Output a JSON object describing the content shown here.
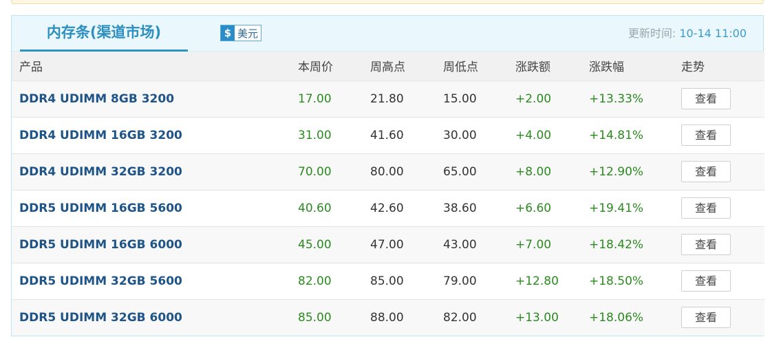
{
  "header": {
    "title": "内存条(渠道市场)",
    "currency_symbol": "$",
    "currency_label": "美元",
    "update_label": "更新时间:",
    "update_value": "10-14 11:00"
  },
  "table": {
    "columns": [
      "产品",
      "本周价",
      "周高点",
      "周低点",
      "涨跌额",
      "涨跌幅",
      "走势"
    ],
    "rows": [
      {
        "product": "DDR4 UDIMM 8GB 3200",
        "price": "17.00",
        "high": "21.80",
        "low": "15.00",
        "change": "+2.00",
        "pct": "+13.33%",
        "trend_btn": "查看"
      },
      {
        "product": "DDR4 UDIMM 16GB 3200",
        "price": "31.00",
        "high": "41.60",
        "low": "30.00",
        "change": "+4.00",
        "pct": "+14.81%",
        "trend_btn": "查看"
      },
      {
        "product": "DDR4 UDIMM 32GB 3200",
        "price": "70.00",
        "high": "80.00",
        "low": "65.00",
        "change": "+8.00",
        "pct": "+12.90%",
        "trend_btn": "查看"
      },
      {
        "product": "DDR5 UDIMM 16GB 5600",
        "price": "40.60",
        "high": "42.60",
        "low": "38.60",
        "change": "+6.60",
        "pct": "+19.41%",
        "trend_btn": "查看"
      },
      {
        "product": "DDR5 UDIMM 16GB 6000",
        "price": "45.00",
        "high": "47.00",
        "low": "43.00",
        "change": "+7.00",
        "pct": "+18.42%",
        "trend_btn": "查看"
      },
      {
        "product": "DDR5 UDIMM 32GB 5600",
        "price": "82.00",
        "high": "85.00",
        "low": "79.00",
        "change": "+12.80",
        "pct": "+18.50%",
        "trend_btn": "查看"
      },
      {
        "product": "DDR5 UDIMM 32GB 6000",
        "price": "85.00",
        "high": "88.00",
        "low": "82.00",
        "change": "+13.00",
        "pct": "+18.06%",
        "trend_btn": "查看"
      }
    ]
  },
  "colors": {
    "title": "#2d8fbf",
    "product": "#1f5488",
    "up": "#2a8a1f",
    "header_bg": "#eaf7fd"
  }
}
